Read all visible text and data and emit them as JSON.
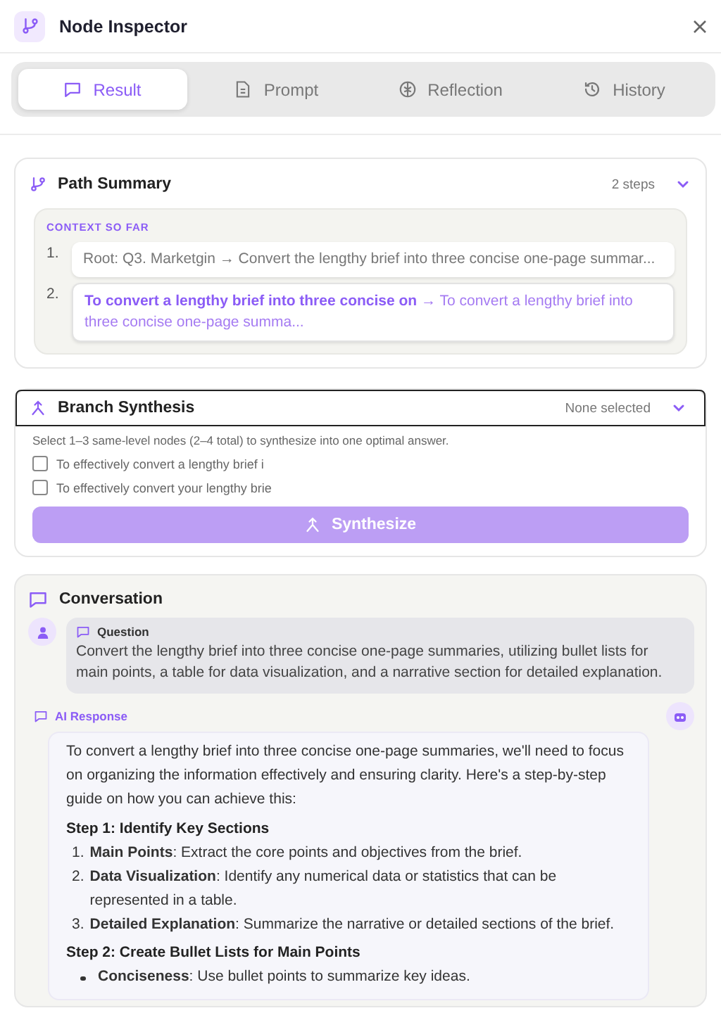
{
  "header": {
    "title": "Node Inspector"
  },
  "tabs": [
    {
      "label": "Result",
      "selected": true
    },
    {
      "label": "Prompt",
      "selected": false
    },
    {
      "label": "Reflection",
      "selected": false
    },
    {
      "label": "History",
      "selected": false
    }
  ],
  "path_summary": {
    "title": "Path Summary",
    "count": "2 steps",
    "section_label": "CONTEXT SO FAR",
    "steps": [
      {
        "number": "1.",
        "text": "Root: Q3. Marketgin → Convert the lengthy brief into three concise one-page summar...",
        "current": false
      },
      {
        "number": "2.",
        "text": "**To convert a lengthy brief into three concise on** → To convert a lengthy brief into three concise one-page summa...",
        "current": true
      }
    ]
  },
  "branch_synthesis": {
    "title": "Branch Synthesis",
    "status": "None selected",
    "hint": "Select 1–3 same-level nodes (2–4 total) to synthesize into one optimal answer.",
    "options": [
      {
        "label": "To effectively convert a lengthy brief i",
        "checked": false
      },
      {
        "label": "To effectively convert your lengthy brie",
        "checked": false
      }
    ],
    "button": {
      "label": "Synthesize",
      "disabled": true
    }
  },
  "conversation": {
    "title": "Conversation",
    "question": {
      "label": "Question",
      "text": "Convert the lengthy brief into three concise one-page summaries, utilizing bullet lists for main points, a table for data visualization, and a narrative section for detailed explanation."
    },
    "response": {
      "label": "AI Response",
      "blocks": [
        {
          "kind": "paragraph",
          "text": "To convert a lengthy brief into three concise one-page summaries, we'll need to focus on organizing the information effectively and ensuring clarity. Here's a step-by-step guide on how you can achieve this:"
        },
        {
          "kind": "heading",
          "text": "Step 1: Identify Key Sections"
        },
        {
          "kind": "numbered",
          "items": [
            {
              "number": "1.",
              "text": "**Main Points**: Extract the core points and objectives from the brief."
            },
            {
              "number": "2.",
              "text": "**Data Visualization**: Identify any numerical data or statistics that can be represented in a table."
            },
            {
              "number": "3.",
              "text": "**Detailed Explanation**: Summarize the narrative or detailed sections of the brief."
            }
          ]
        },
        {
          "kind": "heading",
          "text": "Step 2: Create Bullet Lists for Main Points"
        },
        {
          "kind": "bullets",
          "items": [
            {
              "text": "**Conciseness**: Use bullet points to summarize key ideas."
            }
          ]
        }
      ]
    }
  }
}
